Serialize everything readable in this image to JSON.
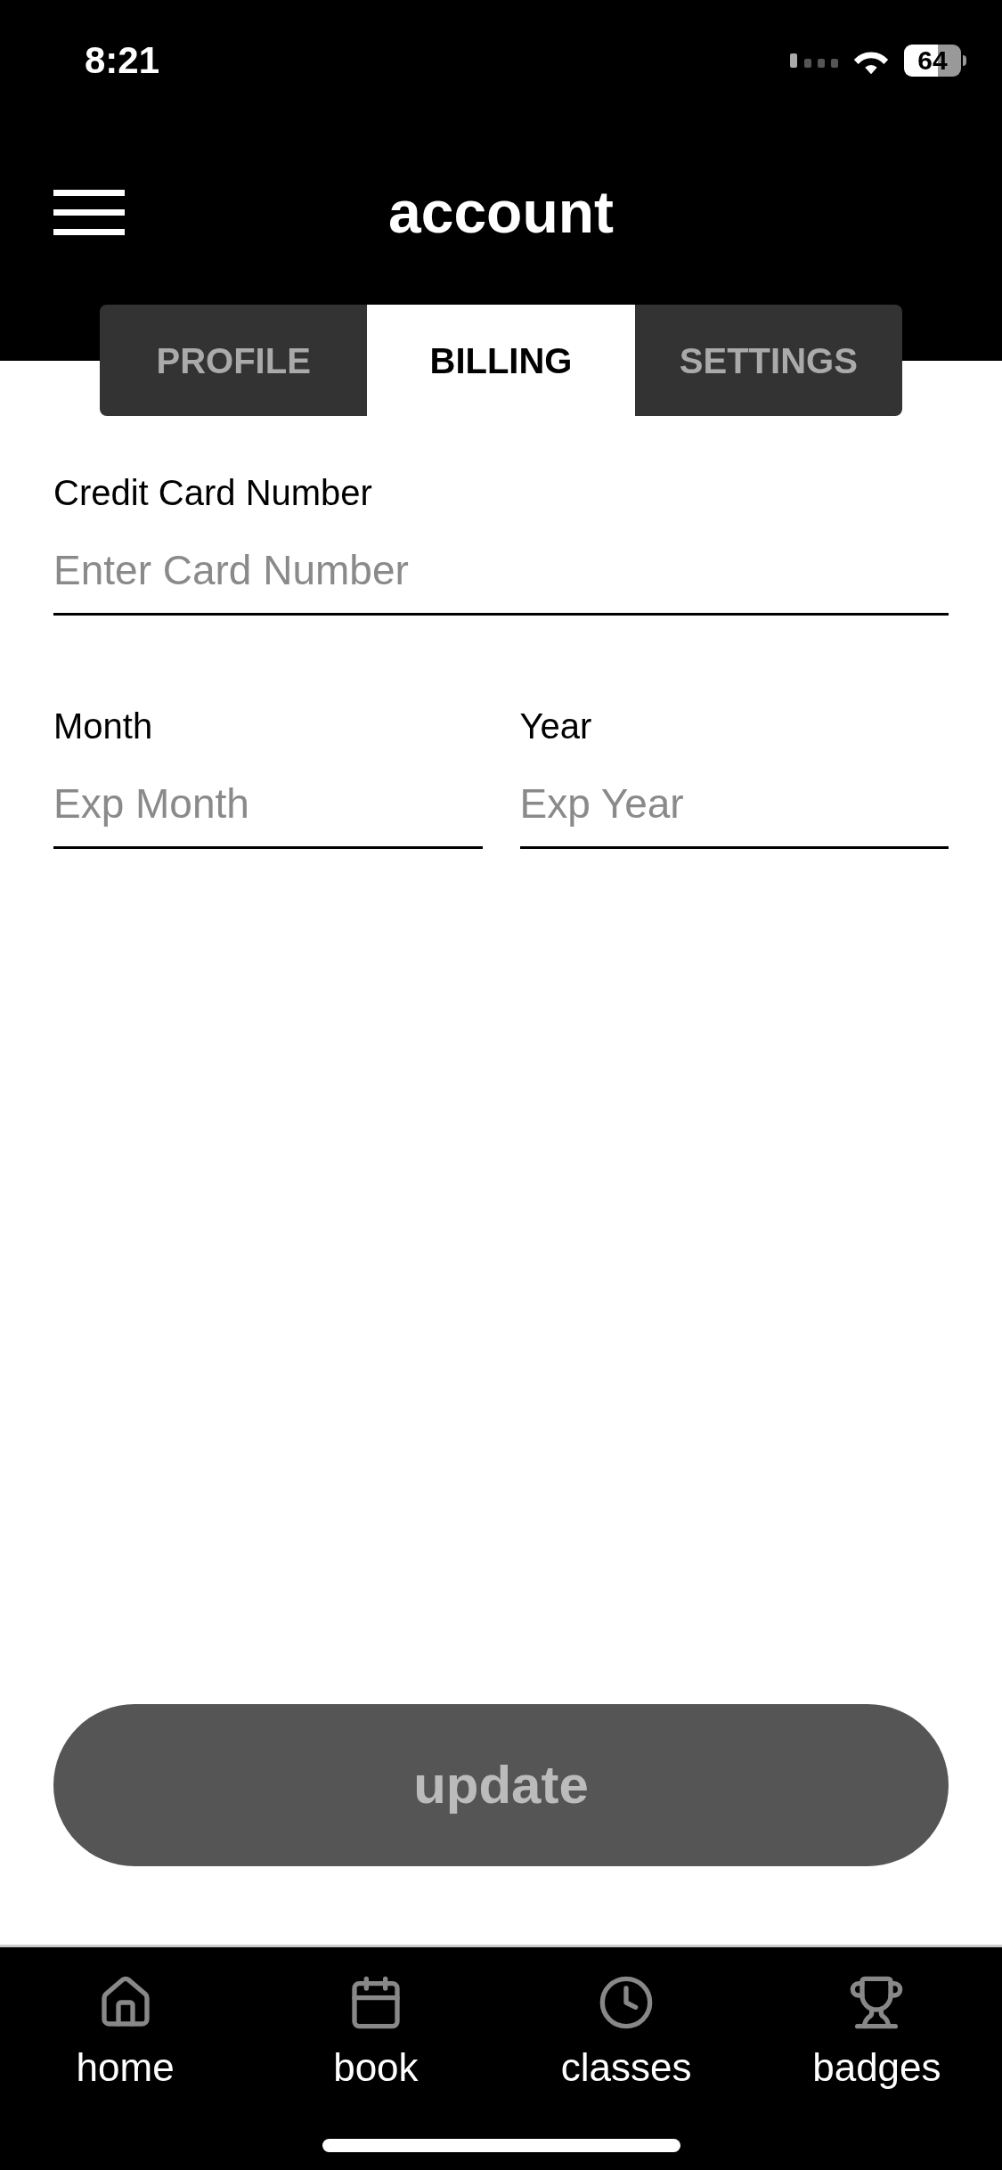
{
  "status_bar": {
    "time": "8:21",
    "battery": "64"
  },
  "header": {
    "title": "account"
  },
  "tabs": [
    {
      "label": "PROFILE",
      "selected": false
    },
    {
      "label": "BILLING",
      "selected": true
    },
    {
      "label": "SETTINGS",
      "selected": false
    }
  ],
  "form": {
    "card_number": {
      "label": "Credit Card Number",
      "placeholder": "Enter Card Number"
    },
    "month": {
      "label": "Month",
      "placeholder": "Exp Month"
    },
    "year": {
      "label": "Year",
      "placeholder": "Exp Year"
    }
  },
  "update_button": "update",
  "nav": [
    {
      "kind": "home",
      "label": "home"
    },
    {
      "kind": "book",
      "label": "book"
    },
    {
      "kind": "classes",
      "label": "classes"
    },
    {
      "kind": "badges",
      "label": "badges"
    }
  ]
}
